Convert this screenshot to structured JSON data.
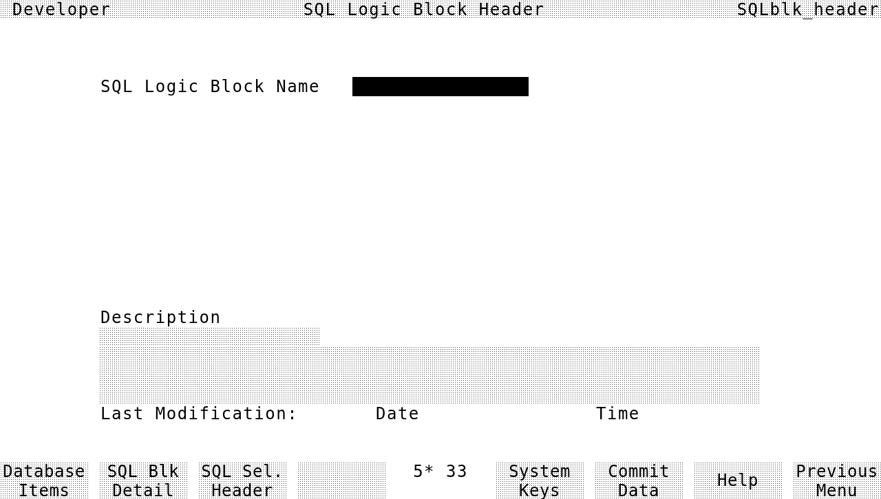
{
  "header": {
    "left": "Developer",
    "title": "SQL Logic Block Header",
    "right": "SQLblk_header"
  },
  "name_field": {
    "label": "SQL Logic Block Name",
    "focused": true
  },
  "description": {
    "label": "Description",
    "focused": false
  },
  "last_modification": {
    "label": "Last Modification:",
    "date_label": "Date",
    "time_label": "Time"
  },
  "softkeys": [
    {
      "kind": "key",
      "lines": [
        "Database",
        "Items"
      ]
    },
    {
      "kind": "key",
      "lines": [
        "SQL Blk",
        "Detail"
      ]
    },
    {
      "kind": "key",
      "lines": [
        "SQL Sel.",
        "Header"
      ]
    },
    {
      "kind": "blank"
    },
    {
      "kind": "status",
      "text": "5* 33"
    },
    {
      "kind": "key",
      "lines": [
        "System",
        "Keys"
      ]
    },
    {
      "kind": "key",
      "lines": [
        "Commit",
        "Data"
      ]
    },
    {
      "kind": "key",
      "lines": [
        "Help"
      ]
    },
    {
      "kind": "key",
      "lines": [
        "Previous",
        "Menu"
      ]
    }
  ]
}
